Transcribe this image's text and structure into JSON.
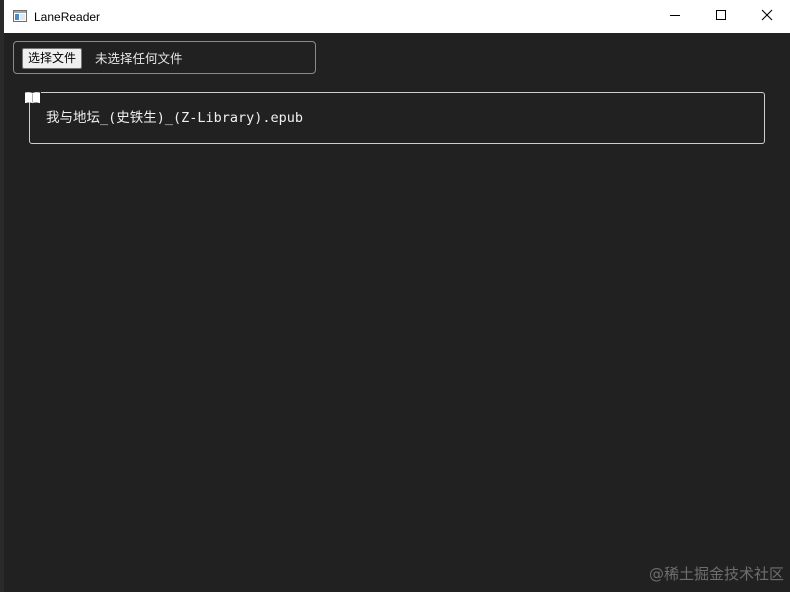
{
  "window": {
    "title": "LaneReader",
    "app_icon": "window-app-icon",
    "controls": {
      "minimize_icon": "minimize-icon",
      "maximize_icon": "maximize-icon",
      "close_icon": "close-icon"
    }
  },
  "file_input": {
    "button_label": "选择文件",
    "status_text": "未选择任何文件"
  },
  "books": [
    {
      "icon": "book-open-icon",
      "filename": "我与地坛_(史铁生)_(Z-Library).epub"
    }
  ],
  "watermark": "@稀土掘金技术社区",
  "colors": {
    "background": "#212121",
    "titlebar": "#ffffff",
    "border": "#cfcfcf",
    "text": "#f0f0f0"
  }
}
